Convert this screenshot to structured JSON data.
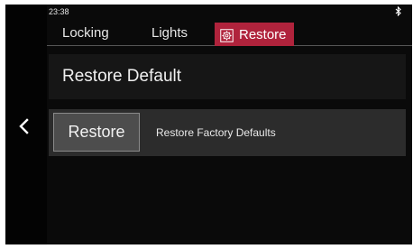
{
  "status": {
    "time": "23:38",
    "bluetooth_icon": "bluetooth-icon"
  },
  "nav": {
    "back_icon": "chevron-left-icon"
  },
  "tabs": [
    {
      "label": "Locking",
      "selected": false
    },
    {
      "label": "Lights",
      "selected": false
    },
    {
      "label": "Restore",
      "selected": true,
      "icon": "restore-gear-icon"
    }
  ],
  "section": {
    "title": "Restore Default"
  },
  "restore_row": {
    "button_label": "Restore",
    "description": "Restore Factory Defaults"
  },
  "colors": {
    "accent": "#b0233c",
    "background": "#0a0a0a",
    "row_background": "#2c2c2c",
    "button_background": "#4d4d4d"
  }
}
